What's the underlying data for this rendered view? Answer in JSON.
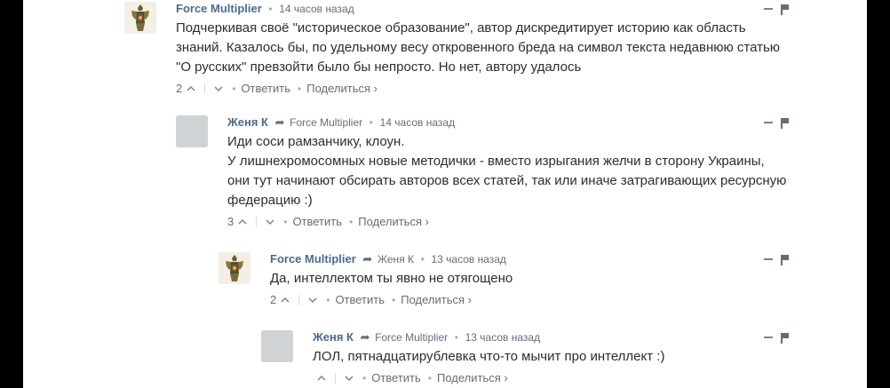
{
  "comments": [
    {
      "author": "Force Multiplier",
      "parent": "",
      "time": "14 часов назад",
      "avatar": "figure-avatar",
      "lines": [
        "Подчеркивая своё \"историческое образование\", автор дискредитирует историю как область знаний. Казалось бы, по удельному весу откровенного бреда на символ текста недавнюю статью \"О русских\" превзойти было бы непросто. Но нет, автору удалось"
      ],
      "votes": "2",
      "reply_label": "Ответить",
      "share_label": "Поделиться ›"
    },
    {
      "author": "Женя К",
      "parent": "Force Multiplier",
      "time": "14 часов назад",
      "avatar": "default-avatar",
      "lines": [
        "Иди соси рамзанчику, клоун.",
        "У лишнехромосомных новые методички - вместо изрыгания желчи в сторону Украины, они тут начинают обсирать авторов всех статей, так или иначе затрагивающих ресурсную федерацию :)"
      ],
      "votes": "3",
      "reply_label": "Ответить",
      "share_label": "Поделиться ›"
    },
    {
      "author": "Force Multiplier",
      "parent": "Женя К",
      "time": "13 часов назад",
      "avatar": "figure-avatar",
      "lines": [
        "Да, интеллектом ты явно не отягощено"
      ],
      "votes": "2",
      "reply_label": "Ответить",
      "share_label": "Поделиться ›"
    },
    {
      "author": "Женя К",
      "parent": "Force Multiplier",
      "time": "13 часов назад",
      "avatar": "default-avatar",
      "lines": [
        "ЛОЛ, пятнадцатирублевка что-то мычит про интеллект :)"
      ],
      "votes": "",
      "reply_label": "Ответить",
      "share_label": "Поделиться ›"
    }
  ],
  "separator_dot": "•",
  "reply_arrow": "➦",
  "colors": {
    "author": "#4c6b8a",
    "meta": "#656c7a",
    "text": "#2a2e2e",
    "side_bars": "#000000"
  }
}
